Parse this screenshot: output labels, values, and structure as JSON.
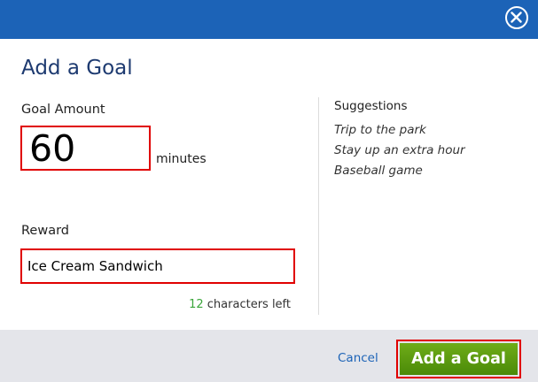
{
  "dialog": {
    "title": "Add a Goal"
  },
  "goal_amount": {
    "label": "Goal Amount",
    "value": "60",
    "unit": "minutes"
  },
  "reward": {
    "label": "Reward",
    "value": "Ice Cream Sandwich",
    "chars_left_count": "12",
    "chars_left_suffix": "characters left"
  },
  "suggestions": {
    "title": "Suggestions",
    "items": [
      "Trip to the park",
      "Stay up an extra hour",
      "Baseball game"
    ]
  },
  "footer": {
    "cancel_label": "Cancel",
    "submit_label": "Add a Goal"
  },
  "colors": {
    "header": "#1c63b7",
    "title": "#1d3a70",
    "highlight": "#e00000",
    "count": "#3aa53a",
    "button": "#5c9c10",
    "footer": "#e4e5ea"
  },
  "icons": {
    "close": "close-icon"
  }
}
